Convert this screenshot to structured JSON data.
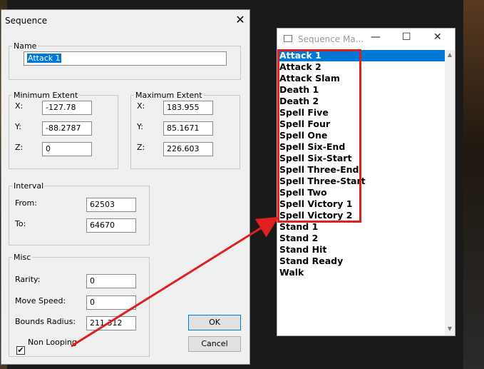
{
  "dialog": {
    "title": "Sequence",
    "name": {
      "legend": "Name",
      "value": "Attack 1"
    },
    "min_extent": {
      "legend": "Minimum Extent",
      "x_label": "X:",
      "x": "-127.78",
      "y_label": "Y:",
      "y": "-88.2787",
      "z_label": "Z:",
      "z": "0"
    },
    "max_extent": {
      "legend": "Maximum Extent",
      "x_label": "X:",
      "x": "183.955",
      "y_label": "Y:",
      "y": "85.1671",
      "z_label": "Z:",
      "z": "226.603"
    },
    "interval": {
      "legend": "Interval",
      "from_label": "From:",
      "from": "62503",
      "to_label": "To:",
      "to": "64670"
    },
    "misc": {
      "legend": "Misc",
      "rarity_label": "Rarity:",
      "rarity": "0",
      "move_speed_label": "Move Speed:",
      "move_speed": "0",
      "bounds_label": "Bounds Radius:",
      "bounds": "211.312",
      "non_looping_label": "Non Looping",
      "non_looping_checked": true
    },
    "ok": "OK",
    "cancel": "Cancel"
  },
  "manager": {
    "title": "Sequence Ma...",
    "items": [
      "Attack 1",
      "Attack 2",
      "Attack Slam",
      "Death 1",
      "Death 2",
      "Spell Five",
      "Spell Four",
      "Spell One",
      "Spell Six-End",
      "Spell Six-Start",
      "Spell Three-End",
      "Spell Three-Start",
      "Spell Two",
      "Spell Victory 1",
      "Spell Victory 2",
      "Stand 1",
      "Stand 2",
      "Stand Hit",
      "Stand Ready",
      "Walk"
    ],
    "selected_index": 0
  },
  "colors": {
    "selection": "#0078d7",
    "annotation": "#e02020"
  }
}
